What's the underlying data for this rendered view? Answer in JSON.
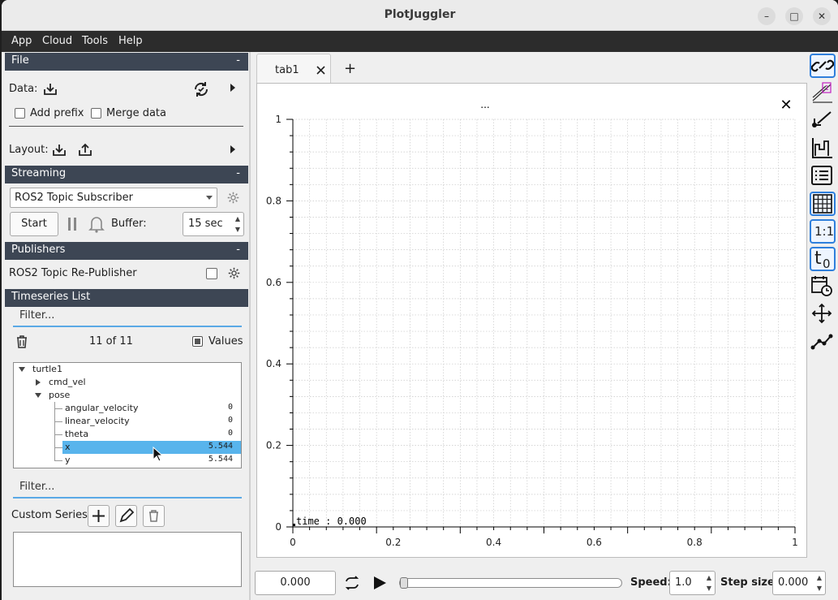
{
  "window": {
    "title": "PlotJuggler"
  },
  "menu": [
    "App",
    "Cloud",
    "Tools",
    "Help"
  ],
  "file_section": {
    "title": "File",
    "collapse": "-",
    "data_label": "Data:",
    "add_prefix_label": "Add prefix",
    "merge_data_label": "Merge data",
    "layout_label": "Layout:"
  },
  "streaming": {
    "title": "Streaming",
    "collapse": "-",
    "selected_plugin": "ROS2 Topic Subscriber",
    "start_label": "Start",
    "buffer_label": "Buffer:",
    "buffer_value": "15 sec"
  },
  "publishers": {
    "title": "Publishers",
    "collapse": "-",
    "item": "ROS2 Topic Re-Publisher"
  },
  "timeseries": {
    "title": "Timeseries List",
    "filter_placeholder": "Filter...",
    "count": "11 of 11",
    "values_label": "Values",
    "tree": [
      {
        "name": "turtle1",
        "value": ""
      },
      {
        "name": "cmd_vel",
        "value": ""
      },
      {
        "name": "pose",
        "value": ""
      },
      {
        "name": "angular_velocity",
        "value": "0"
      },
      {
        "name": "linear_velocity",
        "value": "0"
      },
      {
        "name": "theta",
        "value": "0"
      },
      {
        "name": "x",
        "value": "5.544"
      },
      {
        "name": "y",
        "value": "5.544"
      }
    ]
  },
  "custom": {
    "filter_placeholder": "Filter...",
    "label": "Custom Series:"
  },
  "tabs": [
    {
      "label": "tab1"
    }
  ],
  "add_tab": "+",
  "plot": {
    "title": "...",
    "close": "✕",
    "cursor_label": "time : 0.000"
  },
  "chart_data": {
    "type": "line",
    "title": "",
    "xlabel": "",
    "ylabel": "",
    "xlim": [
      0,
      1
    ],
    "ylim": [
      0,
      1
    ],
    "x_ticks": [
      "0",
      "0.2",
      "0.4",
      "0.6",
      "0.8",
      "1"
    ],
    "y_ticks": [
      "0",
      "0.2",
      "0.4",
      "0.6",
      "0.8",
      "1"
    ],
    "grid": true,
    "series": []
  },
  "toolbar_right": [
    "link-icon",
    "legend-icon",
    "pointer-icon",
    "histogram-icon",
    "list-icon",
    "grid-icon",
    "ratio-icon",
    "time-offset-icon",
    "calendar-clock-icon",
    "move-icon",
    "line-icon"
  ],
  "ratio_label": "1:1",
  "time_offset_label": "t",
  "time_offset_sub": "0",
  "bottom": {
    "time_value": "0.000",
    "speed_label": "Speed:",
    "speed_value": "1.0",
    "step_label": "Step size:",
    "step_value": "0.000",
    "progress": 0.0
  },
  "colors": {
    "accent": "#2f7fdc",
    "selection": "#58b4ec",
    "header": "#3d4654"
  }
}
